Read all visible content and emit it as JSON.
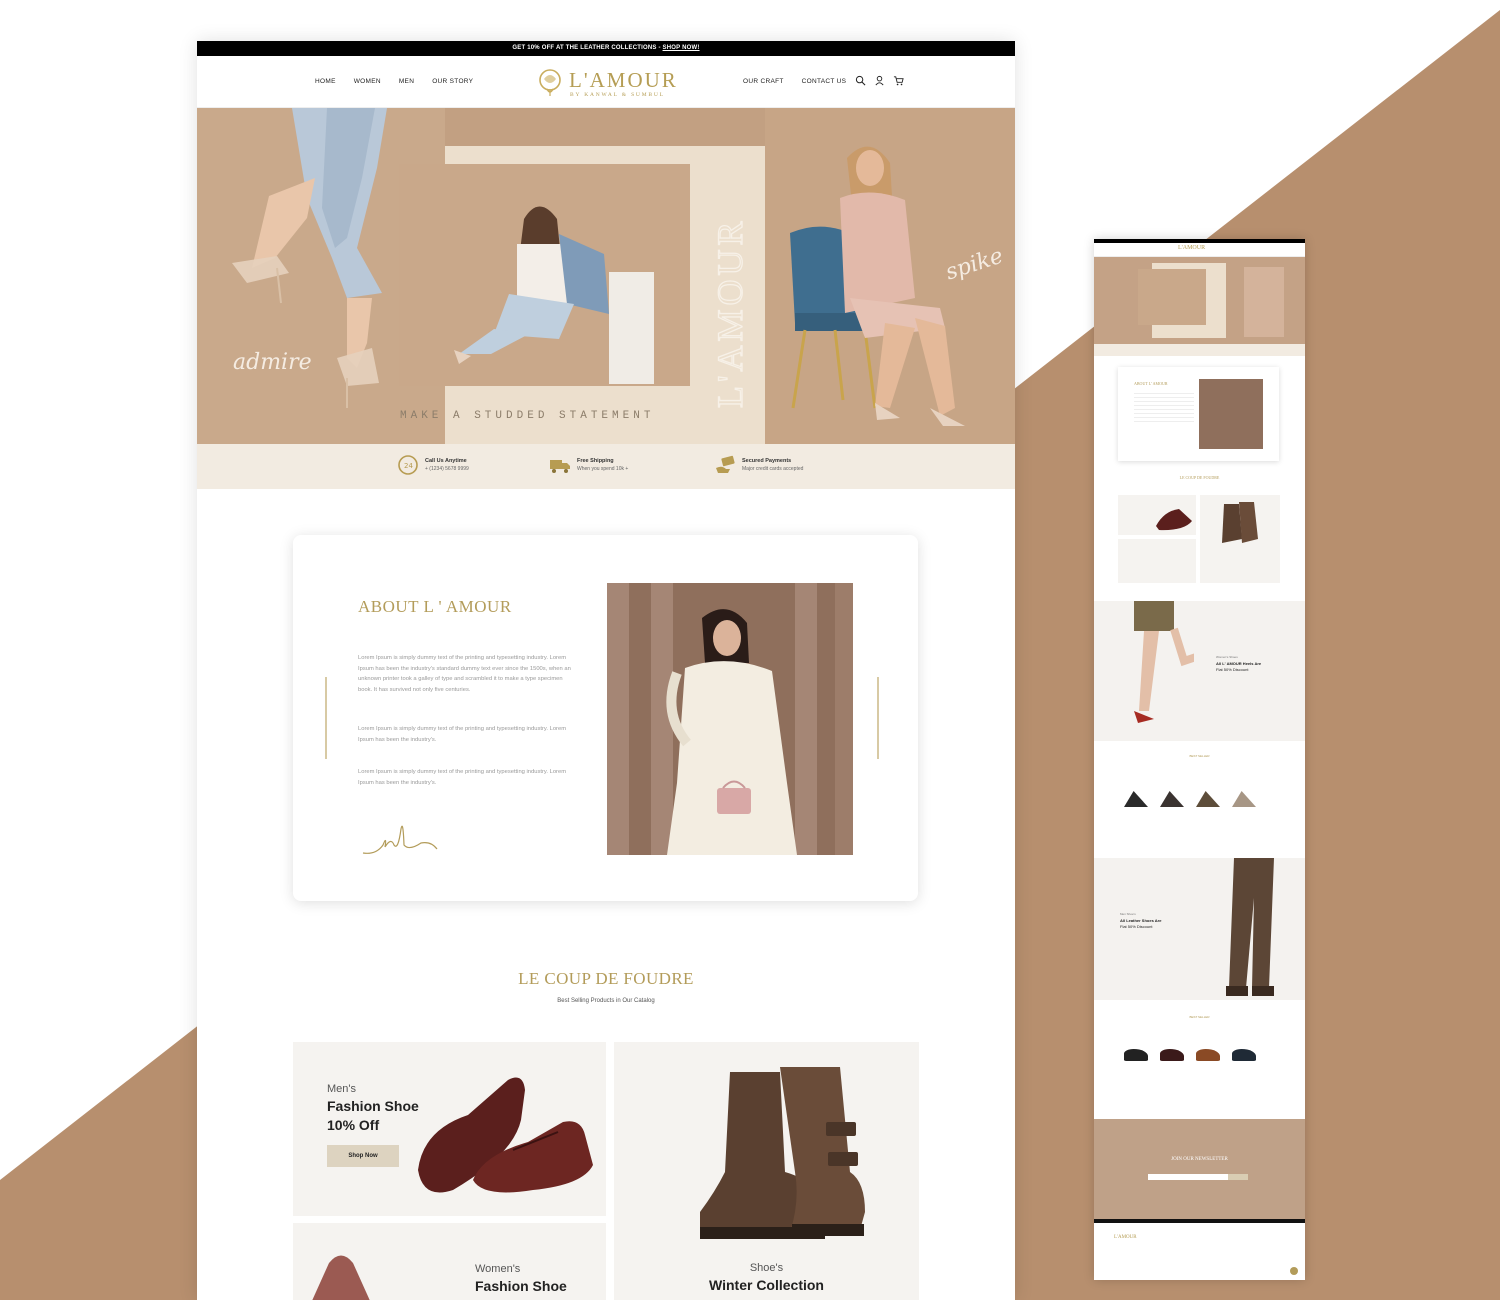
{
  "colors": {
    "accent_gold": "#b39c5a",
    "background_brown": "#b78f6e",
    "hero_tan": "#c2a082",
    "feature_strip": "#f2ebe1"
  },
  "promo": {
    "text": "GET 10% OFF AT THE LEATHER COLLECTIONS -",
    "link": "SHOP NOW!"
  },
  "nav": {
    "left": [
      "HOME",
      "WOMEN",
      "MEN",
      "OUR STORY"
    ],
    "right": [
      "OUR CRAFT",
      "CONTACT US"
    ]
  },
  "brand": {
    "name": "L'AMOUR",
    "subtitle": "BY KANWAL & SUMBUL"
  },
  "icons": [
    "search-icon",
    "user-icon",
    "cart-icon"
  ],
  "hero": {
    "vertical_text": "L'AMOUR",
    "tagline": "MAKE A STUDDED STATEMENT",
    "script_left": "admire",
    "script_right": "spike"
  },
  "features": [
    {
      "title": "Call Us Anytime",
      "sub": "+ (1234) 5678 9999",
      "icon": "phone-24-icon"
    },
    {
      "title": "Free Shipping",
      "sub": "When you spend 10k +",
      "icon": "truck-icon"
    },
    {
      "title": "Secured Payments",
      "sub": "Major credit cards accepted",
      "icon": "hand-card-icon"
    }
  ],
  "about": {
    "title": "ABOUT L ' AMOUR",
    "para1": "Lorem Ipsum is simply dummy text of the printing and typesetting industry. Lorem Ipsum has been the industry's standard dummy text ever since the 1500s, when an unknown printer took a galley of type and scrambled it to make a type specimen book. It has survived not only five centuries.",
    "para2": "Lorem Ipsum is simply dummy text of the printing and typesetting industry. Lorem Ipsum has been the industry's.",
    "para3": "Lorem Ipsum is simply dummy text of the printing and typesetting industry. Lorem Ipsum has been the industry's."
  },
  "catalog": {
    "title": "LE COUP DE FOUDRE",
    "subtitle": "Best Selling Products in Our Catalog",
    "products": [
      {
        "small": "Men's",
        "big1": "Fashion Shoe",
        "big2": "10% Off",
        "button": "Shop Now"
      },
      {
        "small": "Shoe's",
        "big1": "Winter Collection"
      },
      {
        "small": "Women's",
        "big1": "Fashion Shoe"
      }
    ]
  },
  "long_page": {
    "about_title": "ABOUT L' AMOUR",
    "coup_title": "LE COUP DE FOUDRE",
    "women_promo": {
      "small": "Women's Shoes",
      "big1": "All L' AMOUR Heels Are",
      "big2": "Flat 50% Discount"
    },
    "men_promo": {
      "small": "Men Shoe's",
      "big1": "All Leather Shoes Are",
      "big2": "Flat 50% Discount"
    },
    "best_seller": "BEST SELLER",
    "newsletter": "JOIN OUR NEWSLETTER",
    "footer_brand": "L'AMOUR"
  }
}
